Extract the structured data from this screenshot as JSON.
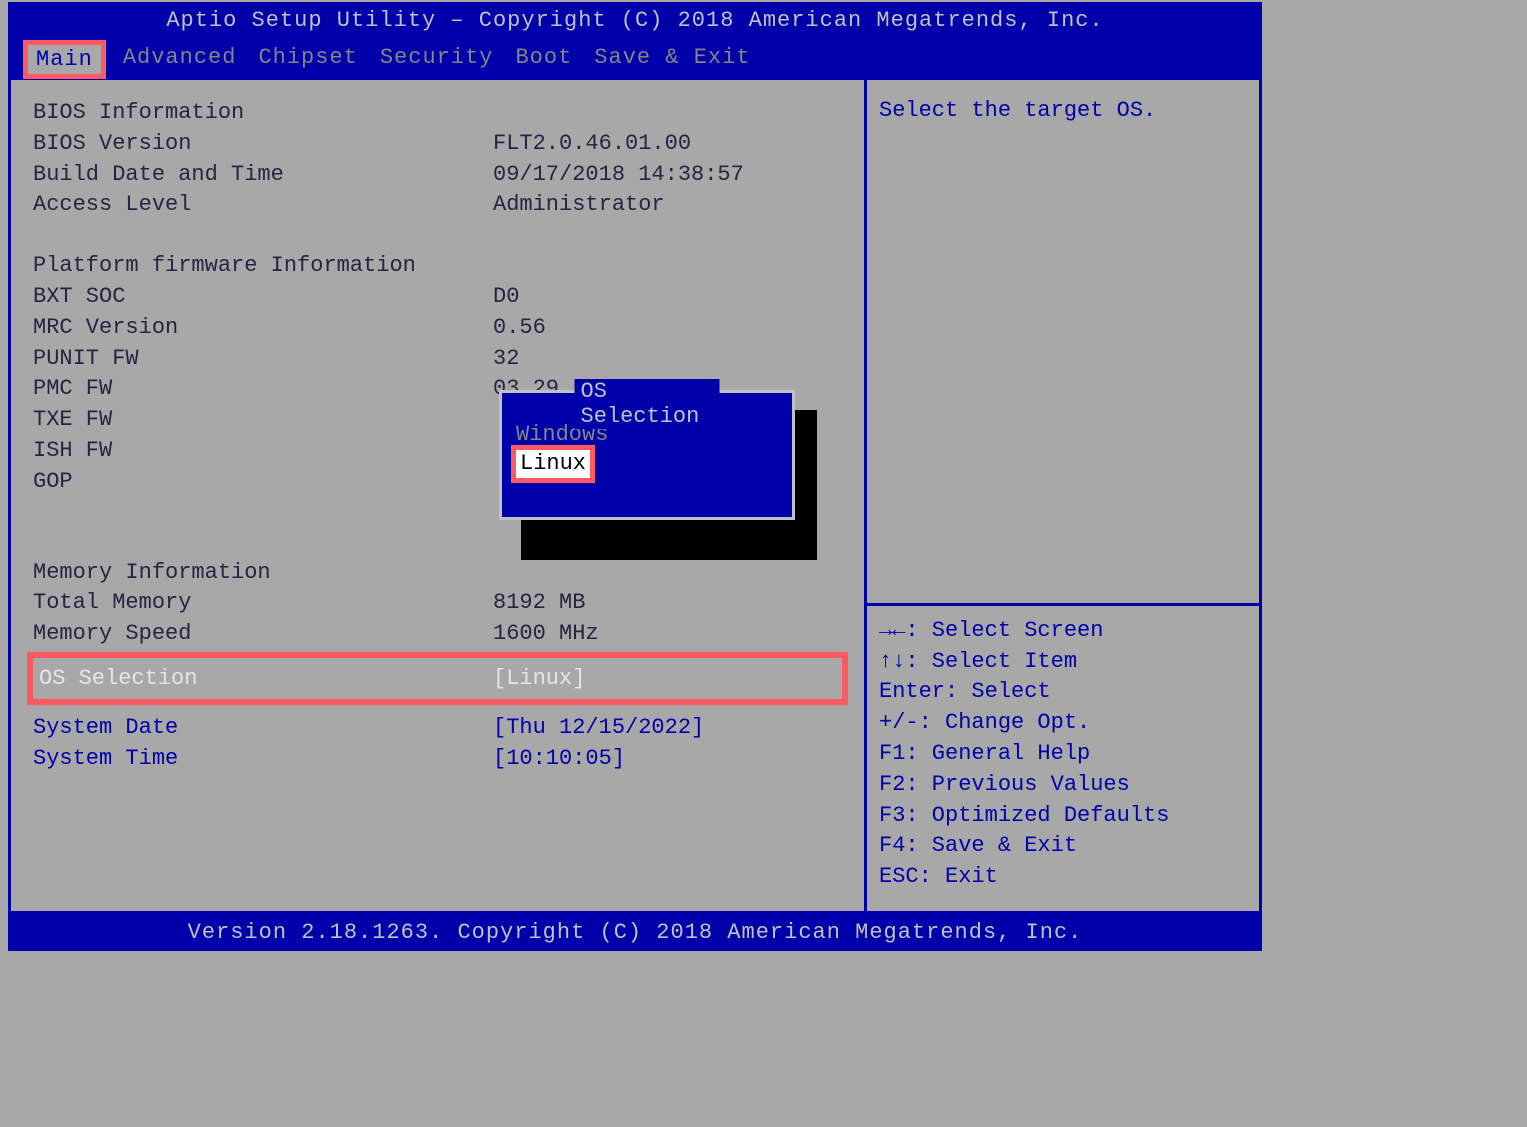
{
  "header": {
    "title": "Aptio Setup Utility – Copyright (C) 2018 American Megatrends, Inc."
  },
  "tabs": [
    {
      "label": "Main",
      "active": true
    },
    {
      "label": "Advanced",
      "active": false
    },
    {
      "label": "Chipset",
      "active": false
    },
    {
      "label": "Security",
      "active": false
    },
    {
      "label": "Boot",
      "active": false
    },
    {
      "label": "Save & Exit",
      "active": false
    }
  ],
  "sections": {
    "bios_info": {
      "header": "BIOS Information",
      "rows": [
        {
          "label": "BIOS Version",
          "value": "FLT2.0.46.01.00"
        },
        {
          "label": "Build Date and Time",
          "value": "09/17/2018 14:38:57"
        },
        {
          "label": "Access Level",
          "value": "Administrator"
        }
      ]
    },
    "platform_info": {
      "header": "Platform firmware Information",
      "rows": [
        {
          "label": "BXT SOC",
          "value": "D0"
        },
        {
          "label": "MRC Version",
          "value": "0.56"
        },
        {
          "label": "PUNIT FW",
          "value": "32"
        },
        {
          "label": "PMC FW",
          "value": "03.29"
        },
        {
          "label": "TXE FW",
          "value": ""
        },
        {
          "label": "ISH FW",
          "value": ""
        },
        {
          "label": "GOP",
          "value": ""
        }
      ]
    },
    "memory_info": {
      "header": "Memory Information",
      "rows": [
        {
          "label": "Total Memory",
          "value": "8192 MB"
        },
        {
          "label": "Memory Speed",
          "value": "1600 MHz"
        }
      ]
    },
    "os_selection": {
      "label": "OS Selection",
      "value": "[Linux]"
    },
    "system_datetime": [
      {
        "label": "System Date",
        "value": "[Thu 12/15/2022]"
      },
      {
        "label": "System Time",
        "value": "[10:10:05]"
      }
    ]
  },
  "popup": {
    "title": "OS Selection",
    "options": [
      {
        "label": "Windows",
        "selected": false
      },
      {
        "label": "Linux",
        "selected": true
      }
    ]
  },
  "help": {
    "text": "Select the target OS.",
    "keys": [
      "→←: Select Screen",
      "↑↓: Select Item",
      "Enter: Select",
      "+/-: Change Opt.",
      "F1: General Help",
      "F2: Previous Values",
      "F3: Optimized Defaults",
      "F4: Save & Exit",
      "ESC: Exit"
    ]
  },
  "footer": {
    "text": "Version 2.18.1263. Copyright (C) 2018 American Megatrends, Inc."
  }
}
